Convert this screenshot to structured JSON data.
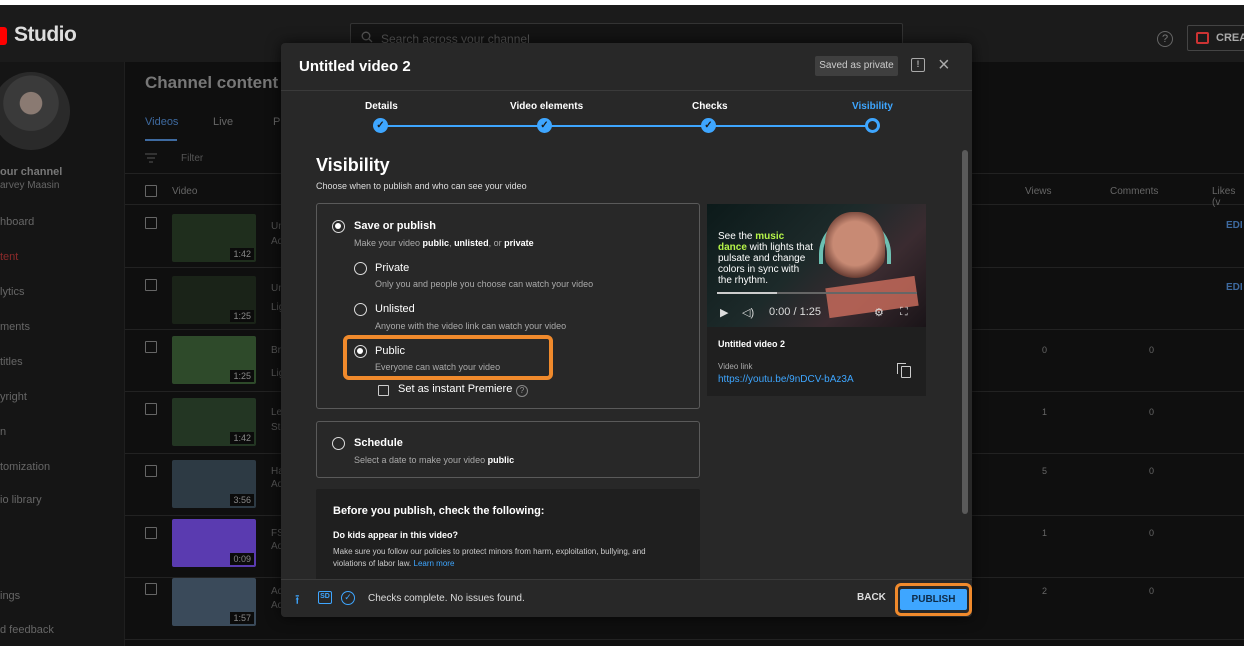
{
  "app": {
    "name": "Studio"
  },
  "topbar": {
    "search_placeholder": "Search across your channel",
    "help": "?",
    "create_label": "CREAT"
  },
  "sidebar": {
    "channel_label": "our channel",
    "channel_name": "arvey Maasin",
    "items": [
      "hboard",
      "tent",
      "lytics",
      "ments",
      "titles",
      "yright",
      "n",
      "tomization",
      "io library",
      "ings",
      "d feedback"
    ]
  },
  "main": {
    "title": "Channel content",
    "tabs": [
      "Videos",
      "Live",
      "P"
    ],
    "filter": "Filter",
    "columns": {
      "video": "Video",
      "views": "Views",
      "comments": "Comments",
      "likes": "Likes (v"
    },
    "edit": "EDI",
    "rows": [
      {
        "title": "Un",
        "sub": "Ad",
        "duration": "1:42",
        "views": "",
        "comments": "",
        "edit": true
      },
      {
        "title": "Un",
        "sub": "Lig",
        "duration": "1:25",
        "views": "",
        "comments": "",
        "edit": true
      },
      {
        "title": "Bri",
        "sub": "Lig",
        "duration": "1:25",
        "views": "0",
        "comments": "0",
        "edit": false
      },
      {
        "title": "Le",
        "sub": "Ste",
        "duration": "1:42",
        "views": "1",
        "comments": "0",
        "edit": false
      },
      {
        "title": "Ha",
        "sub": "Ad",
        "duration": "3:56",
        "views": "5",
        "comments": "0",
        "edit": false
      },
      {
        "title": "FS",
        "sub": "Ad",
        "duration": "0:09",
        "views": "1",
        "comments": "0",
        "edit": false
      },
      {
        "title": "Ad",
        "sub": "Ad",
        "duration": "1:57",
        "views": "2",
        "comments": "0",
        "edit": false
      }
    ]
  },
  "modal": {
    "title": "Untitled video 2",
    "saved_badge": "Saved as private",
    "steps": [
      "Details",
      "Video elements",
      "Checks",
      "Visibility"
    ],
    "visibility": {
      "title": "Visibility",
      "subtitle": "Choose when to publish and who can see your video",
      "save_publish": {
        "title": "Save or publish",
        "sub_prefix": "Make your video ",
        "sub_public": "public",
        "sub_sep1": ", ",
        "sub_unlisted": "unlisted",
        "sub_sep2": ", or ",
        "sub_private": "private"
      },
      "options": [
        {
          "title": "Private",
          "sub": "Only you and people you choose can watch your video",
          "selected": false
        },
        {
          "title": "Unlisted",
          "sub": "Anyone with the video link can watch your video",
          "selected": false
        },
        {
          "title": "Public",
          "sub": "Everyone can watch your video",
          "selected": true
        }
      ],
      "premiere": "Set as instant Premiere",
      "schedule": {
        "title": "Schedule",
        "sub_prefix": "Select a date to make your video ",
        "sub_bold": "public"
      },
      "checklist": {
        "title": "Before you publish, check the following:",
        "question": "Do kids appear in this video?",
        "text": "Make sure you follow our policies to protect minors from harm, exploitation, bullying, and violations of labor law.",
        "link": "Learn more"
      }
    },
    "preview": {
      "overlay_pre": "See the ",
      "overlay_music": "music",
      "overlay_dance": "dance",
      "overlay_rest": " with lights that pulsate and change colors in sync with the rhythm.",
      "time": "0:00 / 1:25",
      "title": "Untitled video 2",
      "link_label": "Video link",
      "link": "https://youtu.be/9nDCV-bAz3A"
    },
    "footer": {
      "sd": "SD",
      "status": "Checks complete. No issues found.",
      "back": "BACK",
      "publish": "PUBLISH"
    }
  },
  "colors": {
    "accent": "#3ea6ff",
    "highlight": "#f08a2c",
    "modal_bg": "#282828"
  }
}
